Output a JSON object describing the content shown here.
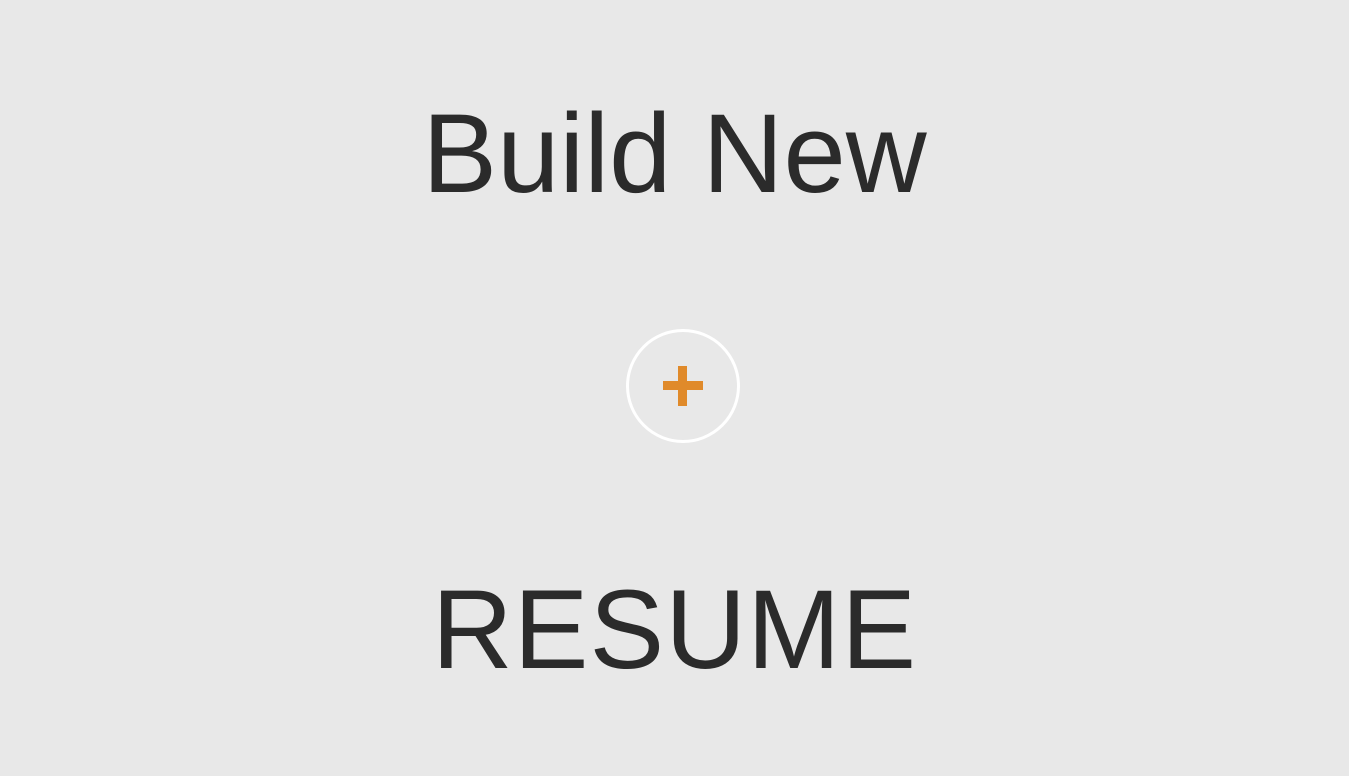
{
  "card": {
    "title_line1": "Build New",
    "title_line2": "RESUME",
    "add_icon": "plus-icon"
  },
  "colors": {
    "background": "#e8e8e8",
    "text": "#2b2b2b",
    "button_border": "#ffffff",
    "accent": "#e08a2a"
  }
}
